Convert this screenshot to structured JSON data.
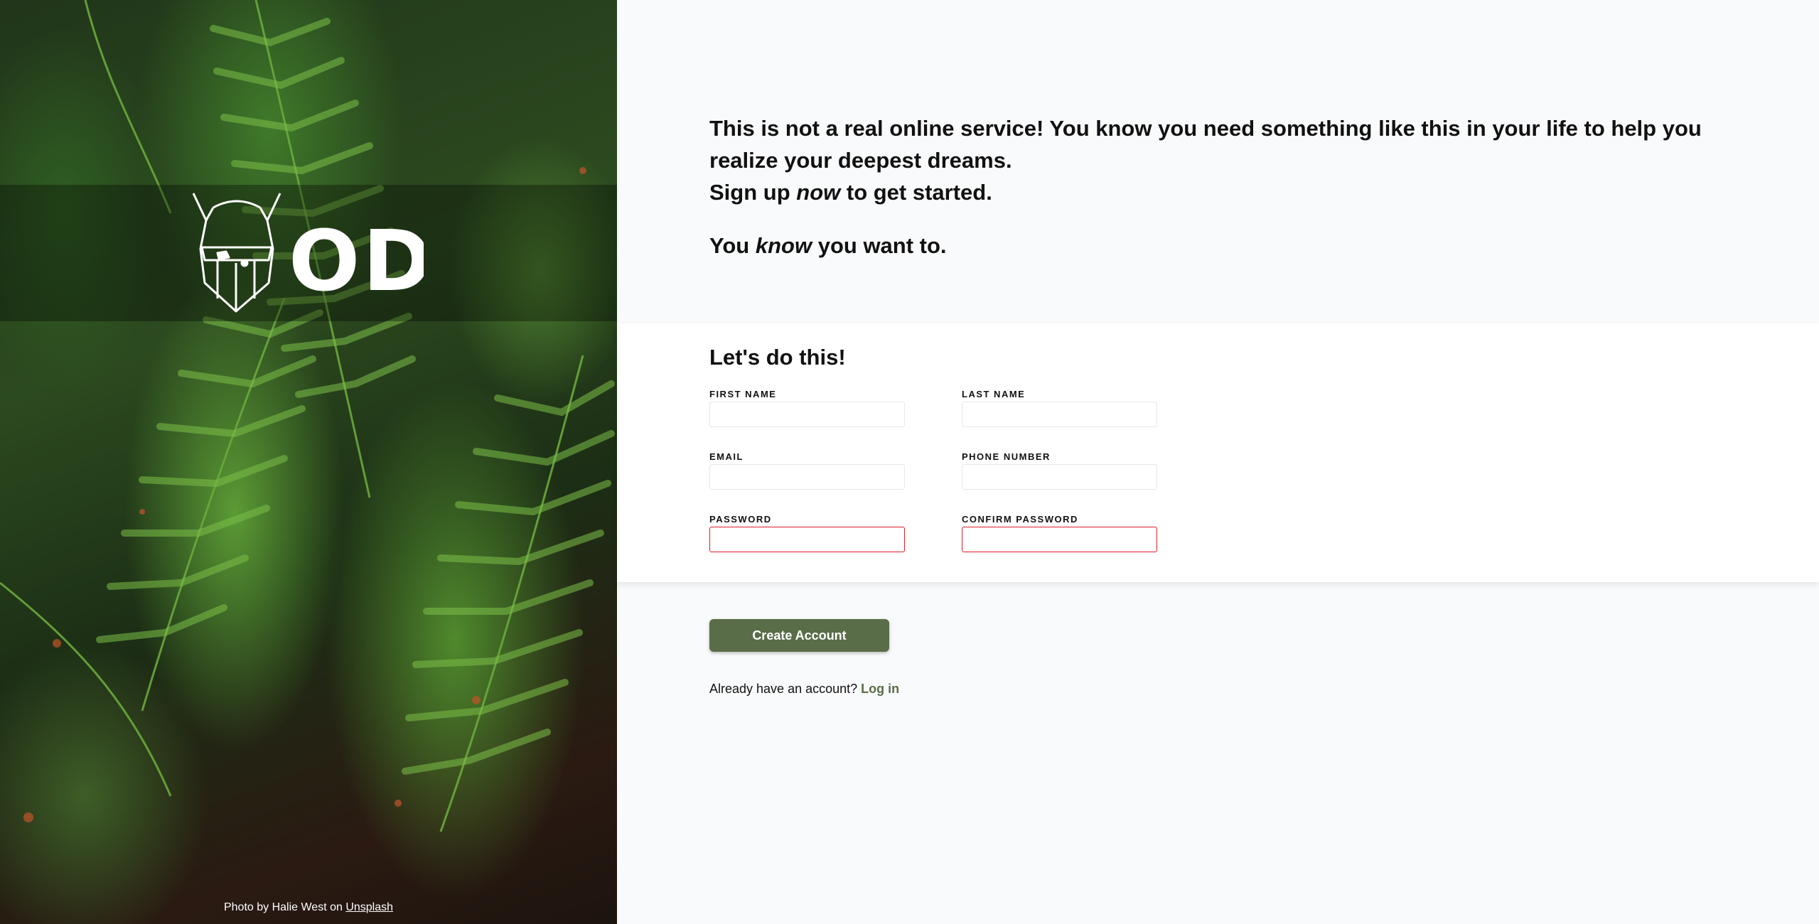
{
  "brand": {
    "logo_text": "ODIN",
    "logo_icon": "viking-helmet-icon"
  },
  "photo_credit": {
    "prefix": "Photo by Halie West on",
    "link": "Unsplash"
  },
  "intro": {
    "line1": "This is not a real online service! You know you need something like this in your life to help you realize your deepest dreams.",
    "line2_before": "Sign up ",
    "line2_em": "now",
    "line2_after": " to get started.",
    "line3_before": "You ",
    "line3_em": "know",
    "line3_after": " you want to."
  },
  "form": {
    "title": "Let's do this!",
    "fields": {
      "first_name": "FIRST NAME",
      "last_name": "LAST NAME",
      "email": "EMAIL",
      "phone": "PHONE NUMBER",
      "password": "PASSWORD",
      "confirm_password": "CONFIRM PASSWORD"
    }
  },
  "actions": {
    "create_account": "Create Account",
    "login_prompt": "Already have an account?",
    "login_link": "Log in"
  },
  "colors": {
    "accent": "#596d48",
    "invalid_border": "#e11d2a",
    "background": "#f9fafb"
  }
}
